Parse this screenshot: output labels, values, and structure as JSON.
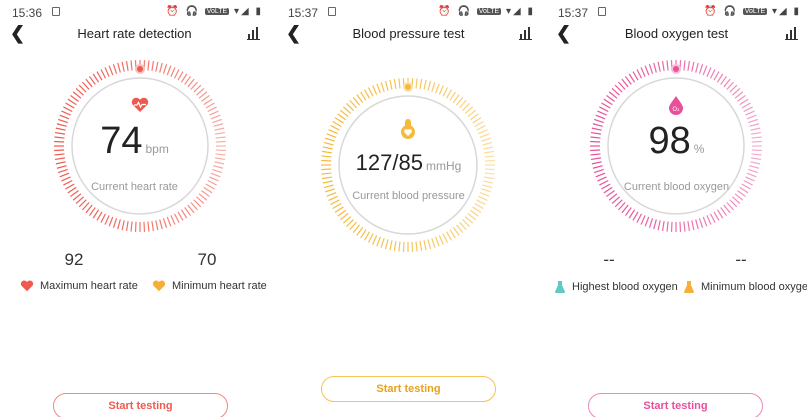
{
  "colors": {
    "heart": "#ef5a4e",
    "pressure": "#f6b93b",
    "oxygen": "#e8509a",
    "ring": "#d8d8d8",
    "min_icon": "#f6b03a",
    "teal": "#5fc9c4"
  },
  "screens": [
    {
      "status": {
        "time": "15:36"
      },
      "header": {
        "title": "Heart rate detection"
      },
      "reading": {
        "value": "74",
        "unit": "bpm",
        "caption": "Current heart rate"
      },
      "stats": {
        "left": "92",
        "right": "70"
      },
      "legend": {
        "left": "Maximum heart rate",
        "right": "Minimum heart rate"
      },
      "button": "Start testing"
    },
    {
      "status": {
        "time": "15:37"
      },
      "header": {
        "title": "Blood pressure test"
      },
      "reading": {
        "value": "127/85",
        "unit": "mmHg",
        "caption": "Current blood pressure"
      },
      "button": "Start testing"
    },
    {
      "status": {
        "time": "15:37"
      },
      "header": {
        "title": "Blood oxygen test"
      },
      "reading": {
        "value": "98",
        "unit": "%",
        "caption": "Current blood oxygen"
      },
      "stats": {
        "left": "--",
        "right": "--"
      },
      "legend": {
        "left": "Highest blood oxygen",
        "right": "Minimum blood oxygen"
      },
      "button": "Start testing"
    }
  ]
}
